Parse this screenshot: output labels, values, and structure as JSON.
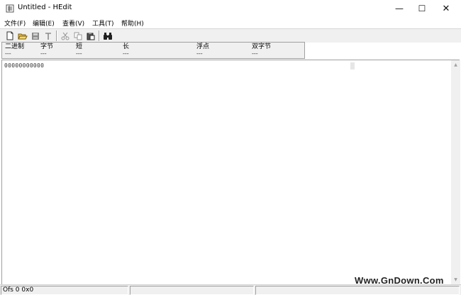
{
  "window": {
    "title": "Untitled - HEdit",
    "minimize_symbol": "—",
    "maximize_symbol": "☐",
    "close_symbol": "✕"
  },
  "menu": {
    "items": [
      "文件(F)",
      "编辑(E)",
      "查看(V)",
      "工具(T)",
      "帮助(H)"
    ]
  },
  "toolbar": {
    "buttons": [
      "new-file-icon",
      "open-folder-icon",
      "save-icon",
      "text-icon",
      "cut-icon",
      "copy-icon",
      "paste-icon",
      "find-binoculars-icon"
    ]
  },
  "info_panel": {
    "columns": [
      {
        "label": "二进制",
        "value": "---"
      },
      {
        "label": "字节",
        "value": "---"
      },
      {
        "label": "短",
        "value": "---"
      },
      {
        "label": "长",
        "value": "---"
      },
      {
        "label": "浮点",
        "value": "---"
      },
      {
        "label": "双字节",
        "value": "---"
      }
    ]
  },
  "editor": {
    "first_line": "00000000000"
  },
  "status": {
    "offset_text": "Ofs 0  0x0"
  },
  "watermark": {
    "text": "Www.GnDown.Com"
  },
  "colors": {
    "chrome": "#f0f0f0",
    "border": "#a0a0a0"
  }
}
